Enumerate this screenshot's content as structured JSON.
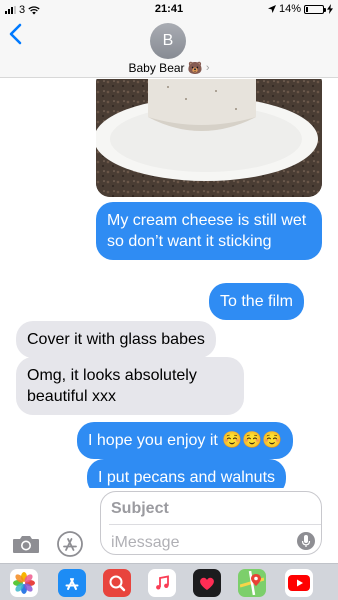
{
  "status_bar": {
    "carrier": "3",
    "time": "21:41",
    "battery": "14%",
    "battery_level": 0.14,
    "icons": [
      "cellular-signal-icon",
      "wifi-icon",
      "location-arrow-icon",
      "battery-icon",
      "charging-bolt-icon"
    ]
  },
  "header": {
    "avatar_initial": "B",
    "contact_name": "Baby Bear 🐻",
    "icons": [
      "back-chevron-icon",
      "chevron-right-icon"
    ]
  },
  "messages": [
    {
      "type": "image",
      "from": "me",
      "description_icon": "cake-photo"
    },
    {
      "type": "text",
      "from": "me",
      "text": "My cream cheese is still wet so don’t want it sticking"
    },
    {
      "type": "text",
      "from": "me",
      "text": "To the film"
    },
    {
      "type": "text",
      "from": "them",
      "text": "Cover it with glass babes"
    },
    {
      "type": "text",
      "from": "them",
      "text": "Omg, it looks absolutely beautiful xxx"
    },
    {
      "type": "text",
      "from": "me",
      "text": "I hope you enjoy it ☺️☺️☺️"
    },
    {
      "type": "text",
      "from": "me",
      "text": "I put pecans and walnuts"
    }
  ],
  "composer": {
    "subject_placeholder": "Subject",
    "message_placeholder": "iMessage",
    "icons": [
      "camera-icon",
      "app-store-icon",
      "microphone-icon"
    ]
  },
  "app_drawer": {
    "apps": [
      "photos-app-icon",
      "app-store-app-icon",
      "web-search-app-icon",
      "music-app-icon",
      "digital-touch-app-icon",
      "maps-app-icon",
      "youtube-app-icon"
    ]
  },
  "colors": {
    "outgoing_bubble": "#2f8cf3",
    "incoming_bubble": "#e6e6eb",
    "accent": "#007aff"
  }
}
